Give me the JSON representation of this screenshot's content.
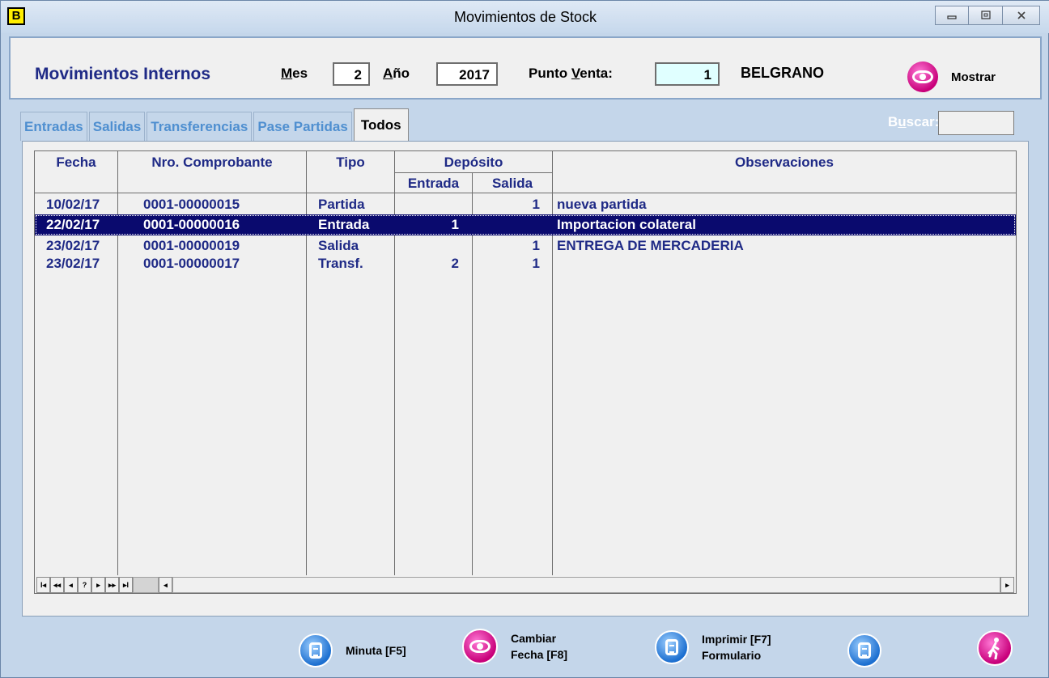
{
  "window": {
    "app_icon": "B",
    "title": "Movimientos de Stock",
    "controls": [
      "minimize-icon",
      "maximize-icon",
      "close-icon"
    ]
  },
  "header": {
    "title": "Movimientos Internos",
    "month_label_u": "M",
    "month_label_rest": "es",
    "month_value": "2",
    "year_label_u": "A",
    "year_label_rest": "ño",
    "year_value": "2017",
    "pos_label_pre": "Punto ",
    "pos_label_u": "V",
    "pos_label_rest": "enta:",
    "pos_value": "1",
    "pos_name": "BELGRANO",
    "show_label": "Mostrar"
  },
  "tabs": [
    {
      "label": "Entradas",
      "active": false
    },
    {
      "label": "Salidas",
      "active": false
    },
    {
      "label": "Transferencias",
      "active": false
    },
    {
      "label": "Pase Partidas",
      "active": false
    },
    {
      "label": "Todos",
      "active": true
    }
  ],
  "search": {
    "label_pre": "B",
    "label_u": "u",
    "label_rest": "scar:",
    "value": ""
  },
  "table": {
    "headers": {
      "fecha": "Fecha",
      "comprobante": "Nro. Comprobante",
      "tipo": "Tipo",
      "deposito": "Depósito",
      "entrada": "Entrada",
      "salida": "Salida",
      "observaciones": "Observaciones"
    },
    "rows": [
      {
        "fecha": "10/02/17",
        "comprobante": "0001-00000015",
        "tipo": "Partida",
        "entrada": "",
        "salida": "1",
        "obs": "nueva partida",
        "selected": false
      },
      {
        "fecha": "22/02/17",
        "comprobante": "0001-00000016",
        "tipo": "Entrada",
        "entrada": "1",
        "salida": "",
        "obs": "Importacion colateral",
        "selected": true
      },
      {
        "fecha": "23/02/17",
        "comprobante": "0001-00000019",
        "tipo": "Salida",
        "entrada": "",
        "salida": "1",
        "obs": "ENTREGA DE MERCADERIA",
        "selected": false
      },
      {
        "fecha": "23/02/17",
        "comprobante": "0001-00000017",
        "tipo": "Transf.",
        "entrada": "2",
        "salida": "1",
        "obs": "",
        "selected": false
      }
    ]
  },
  "navigator": {
    "buttons": [
      "I◂",
      "◂◂",
      "◂",
      "?",
      "▸",
      "▸▸",
      "▸I"
    ],
    "scroll_left": "◂",
    "scroll_right": "▸"
  },
  "bottom": {
    "minuta": "Minuta [F5]",
    "cambiar_1": "Cambiar",
    "cambiar_2": "Fecha [F8]",
    "imprimir_1": "Imprimir [F7]",
    "imprimir_2": "Formulario"
  }
}
